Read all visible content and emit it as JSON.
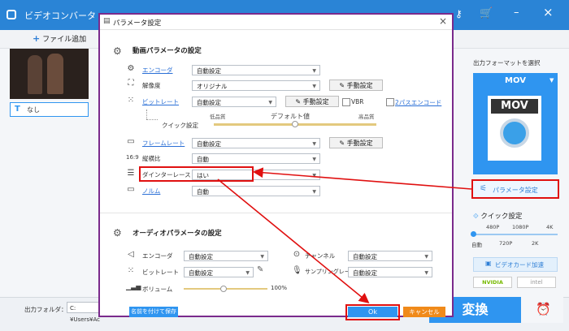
{
  "app": {
    "title": "ビデオコンバータ",
    "add_file": "ファイル追加",
    "subtitle_none": "なし",
    "output_folder_label": "出力フォルダ：",
    "output_folder_value": "C:¥Users¥Ac",
    "convert_label": "変換",
    "right_panel": {
      "select_format": "出力フォーマットを選択",
      "format": "MOV",
      "format_badge": "MOV",
      "param_settings": "パラメータ設定",
      "quick_settings": "クイック設定",
      "res_top": [
        "480P",
        "1080P",
        "4K"
      ],
      "res_bottom": [
        "自動",
        "720P",
        "2K"
      ],
      "gpu_accel": "ビデオカード加速",
      "gpu_vendors": [
        "NVIDIA",
        "intel"
      ]
    }
  },
  "dialog": {
    "title": "パラメータ設定",
    "close": "×",
    "video_section_title": "動画パラメータの設定",
    "audio_section_title": "オーディオパラメータの設定",
    "video": {
      "encoder_label": "エンコーダ",
      "encoder_value": "自動設定",
      "resolution_label": "解像度",
      "resolution_value": "オリジナル",
      "manual_label": "手動設定",
      "bitrate_label": "ビットレート",
      "bitrate_value": "自動設定",
      "vbr_label": "VBR",
      "two_pass_label": "2パスエンコード",
      "quick_label": "クイック設定",
      "low_quality": "低品質",
      "default_value": "デフォルト値",
      "high_quality": "高品質",
      "framerate_label": "フレームレート",
      "framerate_value": "自動設定",
      "aspect_label": "縦横比",
      "aspect_value": "自動",
      "deinterlace_label": "ダインターレース",
      "deinterlace_value": "はい",
      "zoom_label": "ノルム",
      "zoom_value": "自動"
    },
    "audio": {
      "encoder_label": "エンコーダ",
      "encoder_value": "自動設定",
      "bitrate_label": "ビットレート",
      "bitrate_value": "自動設定",
      "volume_label": "ボリューム",
      "volume_value": "100%",
      "channel_label": "チャンネル",
      "channel_value": "自動設定",
      "sample_label": "サンプリングレート",
      "sample_value": "自動設定"
    },
    "save_as": "名前を付けて保存",
    "ok": "Ok",
    "cancel": "キャンセル"
  },
  "colors": {
    "titlebar": "#2a84d6",
    "accent": "#2f95f0",
    "dialog_border": "#7a2a8c",
    "highlight_red": "#e01010",
    "cancel": "#f08a1a"
  }
}
